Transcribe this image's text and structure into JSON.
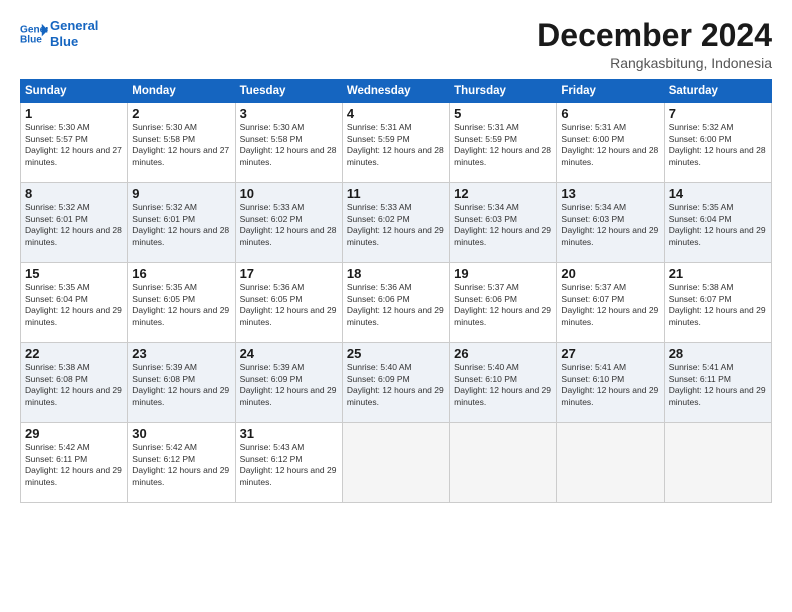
{
  "header": {
    "logo_line1": "General",
    "logo_line2": "Blue",
    "month": "December 2024",
    "location": "Rangkasbitung, Indonesia"
  },
  "days_of_week": [
    "Sunday",
    "Monday",
    "Tuesday",
    "Wednesday",
    "Thursday",
    "Friday",
    "Saturday"
  ],
  "weeks": [
    [
      {
        "num": "1",
        "rise": "5:30 AM",
        "set": "5:57 PM",
        "hours": "12 hours and 27 minutes"
      },
      {
        "num": "2",
        "rise": "5:30 AM",
        "set": "5:58 PM",
        "hours": "12 hours and 27 minutes"
      },
      {
        "num": "3",
        "rise": "5:30 AM",
        "set": "5:58 PM",
        "hours": "12 hours and 28 minutes"
      },
      {
        "num": "4",
        "rise": "5:31 AM",
        "set": "5:59 PM",
        "hours": "12 hours and 28 minutes"
      },
      {
        "num": "5",
        "rise": "5:31 AM",
        "set": "5:59 PM",
        "hours": "12 hours and 28 minutes"
      },
      {
        "num": "6",
        "rise": "5:31 AM",
        "set": "6:00 PM",
        "hours": "12 hours and 28 minutes"
      },
      {
        "num": "7",
        "rise": "5:32 AM",
        "set": "6:00 PM",
        "hours": "12 hours and 28 minutes"
      }
    ],
    [
      {
        "num": "8",
        "rise": "5:32 AM",
        "set": "6:01 PM",
        "hours": "12 hours and 28 minutes"
      },
      {
        "num": "9",
        "rise": "5:32 AM",
        "set": "6:01 PM",
        "hours": "12 hours and 28 minutes"
      },
      {
        "num": "10",
        "rise": "5:33 AM",
        "set": "6:02 PM",
        "hours": "12 hours and 28 minutes"
      },
      {
        "num": "11",
        "rise": "5:33 AM",
        "set": "6:02 PM",
        "hours": "12 hours and 29 minutes"
      },
      {
        "num": "12",
        "rise": "5:34 AM",
        "set": "6:03 PM",
        "hours": "12 hours and 29 minutes"
      },
      {
        "num": "13",
        "rise": "5:34 AM",
        "set": "6:03 PM",
        "hours": "12 hours and 29 minutes"
      },
      {
        "num": "14",
        "rise": "5:35 AM",
        "set": "6:04 PM",
        "hours": "12 hours and 29 minutes"
      }
    ],
    [
      {
        "num": "15",
        "rise": "5:35 AM",
        "set": "6:04 PM",
        "hours": "12 hours and 29 minutes"
      },
      {
        "num": "16",
        "rise": "5:35 AM",
        "set": "6:05 PM",
        "hours": "12 hours and 29 minutes"
      },
      {
        "num": "17",
        "rise": "5:36 AM",
        "set": "6:05 PM",
        "hours": "12 hours and 29 minutes"
      },
      {
        "num": "18",
        "rise": "5:36 AM",
        "set": "6:06 PM",
        "hours": "12 hours and 29 minutes"
      },
      {
        "num": "19",
        "rise": "5:37 AM",
        "set": "6:06 PM",
        "hours": "12 hours and 29 minutes"
      },
      {
        "num": "20",
        "rise": "5:37 AM",
        "set": "6:07 PM",
        "hours": "12 hours and 29 minutes"
      },
      {
        "num": "21",
        "rise": "5:38 AM",
        "set": "6:07 PM",
        "hours": "12 hours and 29 minutes"
      }
    ],
    [
      {
        "num": "22",
        "rise": "5:38 AM",
        "set": "6:08 PM",
        "hours": "12 hours and 29 minutes"
      },
      {
        "num": "23",
        "rise": "5:39 AM",
        "set": "6:08 PM",
        "hours": "12 hours and 29 minutes"
      },
      {
        "num": "24",
        "rise": "5:39 AM",
        "set": "6:09 PM",
        "hours": "12 hours and 29 minutes"
      },
      {
        "num": "25",
        "rise": "5:40 AM",
        "set": "6:09 PM",
        "hours": "12 hours and 29 minutes"
      },
      {
        "num": "26",
        "rise": "5:40 AM",
        "set": "6:10 PM",
        "hours": "12 hours and 29 minutes"
      },
      {
        "num": "27",
        "rise": "5:41 AM",
        "set": "6:10 PM",
        "hours": "12 hours and 29 minutes"
      },
      {
        "num": "28",
        "rise": "5:41 AM",
        "set": "6:11 PM",
        "hours": "12 hours and 29 minutes"
      }
    ],
    [
      {
        "num": "29",
        "rise": "5:42 AM",
        "set": "6:11 PM",
        "hours": "12 hours and 29 minutes"
      },
      {
        "num": "30",
        "rise": "5:42 AM",
        "set": "6:12 PM",
        "hours": "12 hours and 29 minutes"
      },
      {
        "num": "31",
        "rise": "5:43 AM",
        "set": "6:12 PM",
        "hours": "12 hours and 29 minutes"
      },
      null,
      null,
      null,
      null
    ]
  ]
}
